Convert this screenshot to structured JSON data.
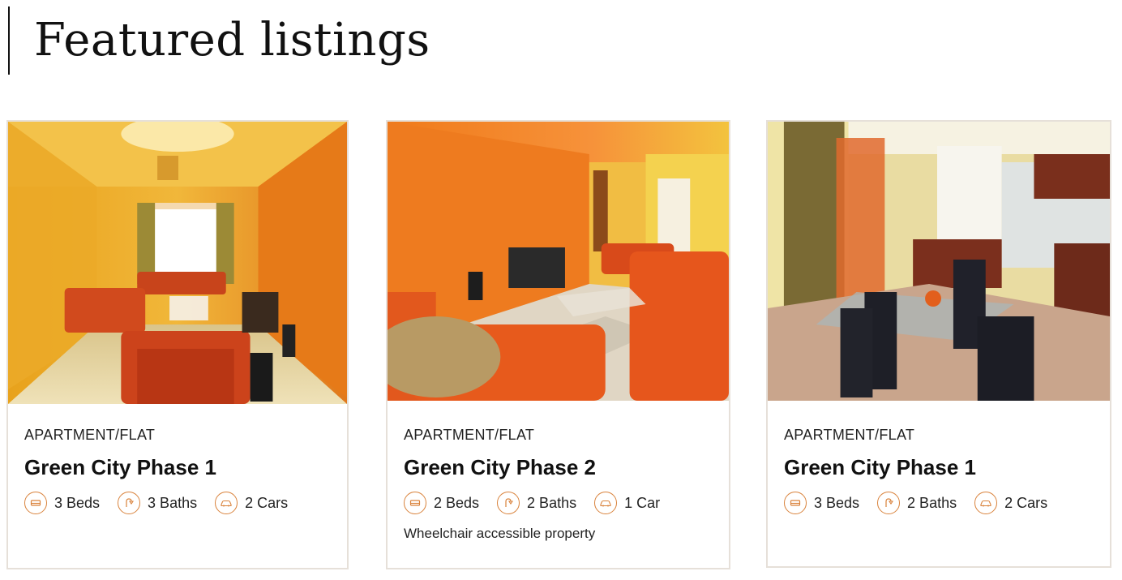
{
  "section": {
    "title": "Featured listings"
  },
  "colors": {
    "accent": "#d9823b",
    "card_border": "#e6e0d9"
  },
  "listings": [
    {
      "type": "APARTMENT/FLAT",
      "name": "Green City Phase 1",
      "beds": "3 Beds",
      "baths": "3 Baths",
      "cars": "2 Cars",
      "note": ""
    },
    {
      "type": "APARTMENT/FLAT",
      "name": "Green City Phase 2",
      "beds": "2 Beds",
      "baths": "2 Baths",
      "cars": "1 Car",
      "note": "Wheelchair accessible property"
    },
    {
      "type": "APARTMENT/FLAT",
      "name": "Green City Phase 1",
      "beds": "3 Beds",
      "baths": "2 Baths",
      "cars": "2 Cars",
      "note": ""
    }
  ],
  "icons": {
    "beds": "bed-icon",
    "baths": "shower-icon",
    "cars": "car-icon"
  }
}
